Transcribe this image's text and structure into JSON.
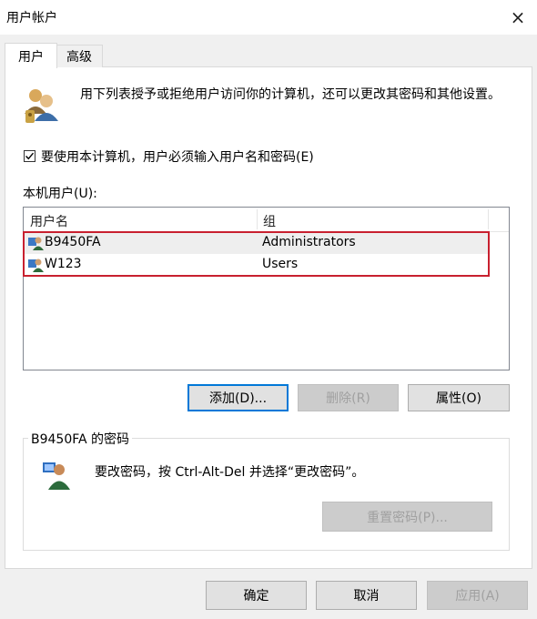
{
  "window": {
    "title": "用户帐户",
    "close_icon": "×"
  },
  "tabs": [
    {
      "label": "用户",
      "active": true
    },
    {
      "label": "高级",
      "active": false
    }
  ],
  "intro": {
    "text": "用下列表授予或拒绝用户访问你的计算机，还可以更改其密码和其他设置。"
  },
  "require_password": {
    "checked": true,
    "label": "要使用本计算机，用户必须输入用户名和密码(E)"
  },
  "users_list": {
    "label": "本机用户(U):",
    "columns": [
      "用户名",
      "组"
    ],
    "rows": [
      {
        "name": "B9450FA",
        "group": "Administrators",
        "selected": true
      },
      {
        "name": "W123",
        "group": "Users",
        "selected": false
      }
    ]
  },
  "actions": {
    "add": "添加(D)...",
    "remove": "删除(R)",
    "properties": "属性(O)"
  },
  "password_group": {
    "title": "B9450FA 的密码",
    "text": "要改密码，按 Ctrl-Alt-Del 并选择“更改密码”。",
    "reset_label": "重置密码(P)..."
  },
  "footer": {
    "ok": "确定",
    "cancel": "取消",
    "apply": "应用(A)"
  },
  "colors": {
    "accent": "#0078d7",
    "highlight_border": "#c8202f"
  }
}
